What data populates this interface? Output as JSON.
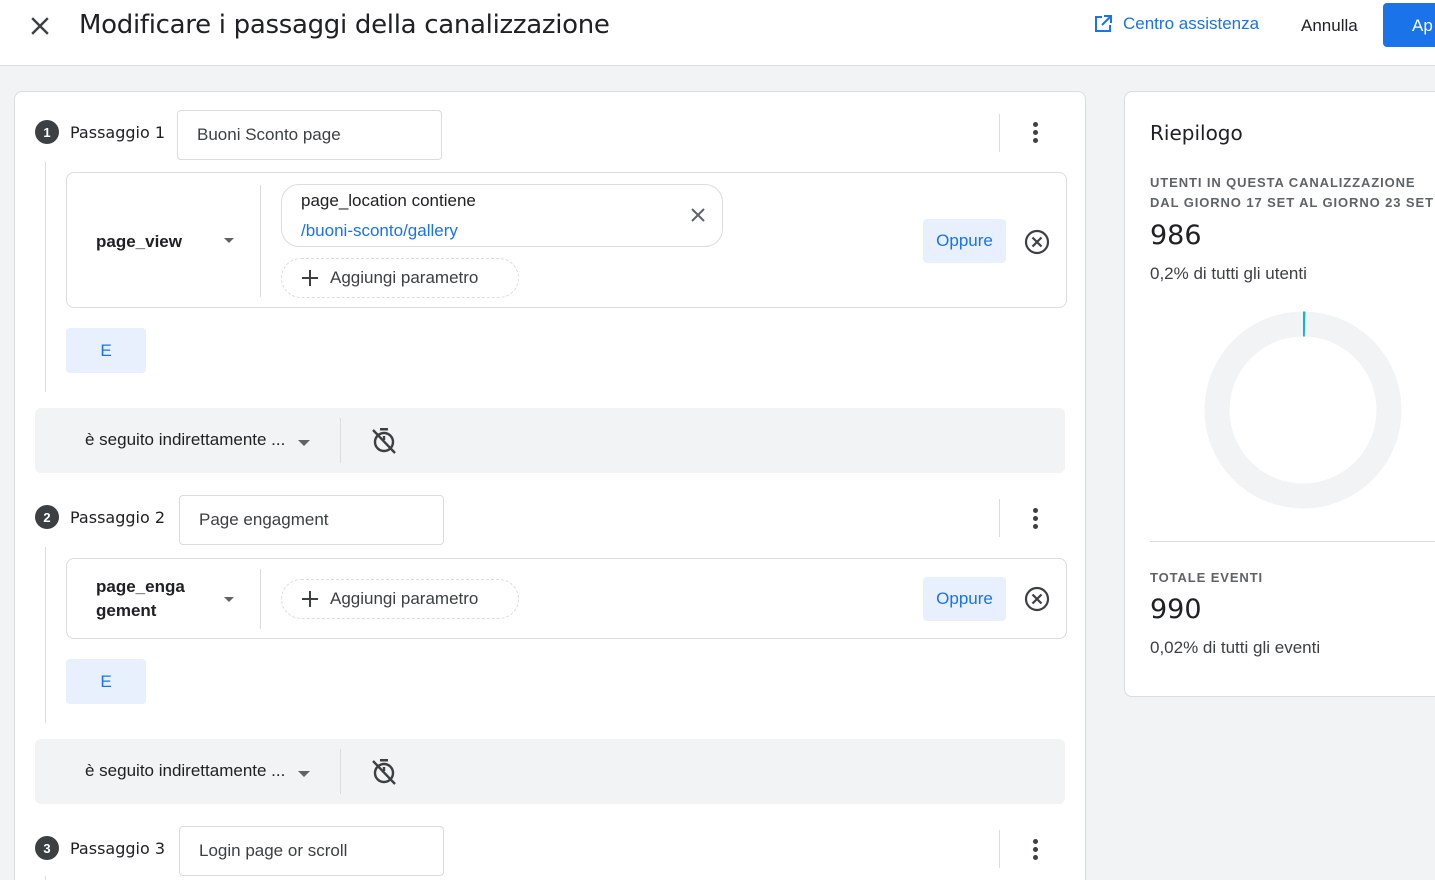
{
  "header": {
    "title": "Modificare i passaggi della canalizzazione",
    "help_label": "Centro assistenza",
    "cancel_label": "Annulla",
    "apply_label": "Ap"
  },
  "steps": [
    {
      "number": "1",
      "label": "Passaggio 1",
      "name": "Buoni Sconto page",
      "event": "page_view",
      "condition": {
        "title": "page_location contiene",
        "value": "/buoni-sconto/gallery"
      },
      "add_param_label": "Aggiungi parametro",
      "or_label": "Oppure",
      "and_label": "E",
      "follow_label": "è seguito indirettamente ..."
    },
    {
      "number": "2",
      "label": "Passaggio 2",
      "name": "Page engagment",
      "event_line1": "page_enga",
      "event_line2": "gement",
      "add_param_label": "Aggiungi parametro",
      "or_label": "Oppure",
      "and_label": "E",
      "follow_label": "è seguito indirettamente ..."
    },
    {
      "number": "3",
      "label": "Passaggio 3",
      "name": "Login page or scroll"
    }
  ],
  "summary": {
    "title": "Riepilogo",
    "users_caption_line1": "UTENTI IN QUESTA CANALIZZAZIONE",
    "users_caption_line2": "DAL GIORNO 17 SET AL GIORNO 23 SET",
    "users_value": "986",
    "users_share": "0,2% di tutti gli utenti",
    "users_fraction": 0.002,
    "events_caption": "TOTALE EVENTI",
    "events_value": "990",
    "events_share": "0,02% di tutti gli eventi"
  },
  "colors": {
    "accent": "#1a73e8",
    "donut_track": "#f1f3f4",
    "donut_fill": "#12b5cb"
  },
  "icons": {
    "close": "close-icon",
    "help": "open-in-new-icon",
    "kebab": "more-vert-icon",
    "remove": "cancel-circle-icon",
    "timer": "timer-off-icon",
    "add": "plus-icon"
  }
}
